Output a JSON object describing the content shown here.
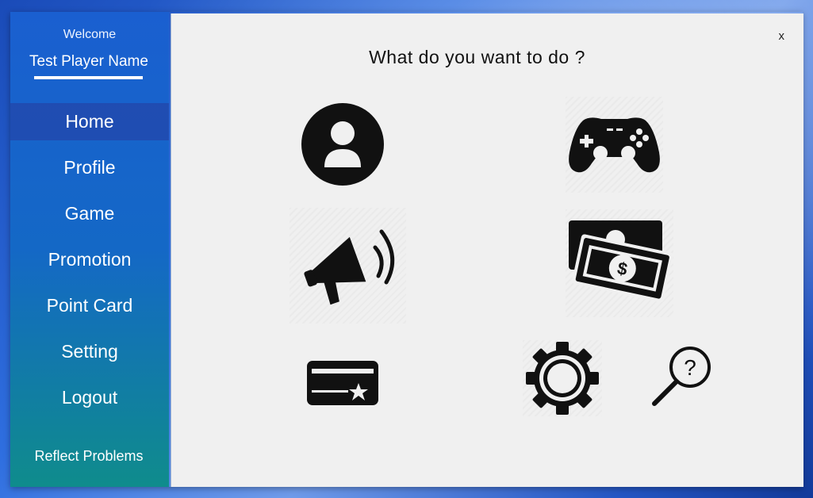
{
  "sidebar": {
    "welcome": "Welcome",
    "player_name": "Test Player Name",
    "items": [
      {
        "label": "Home",
        "active": true
      },
      {
        "label": "Profile",
        "active": false
      },
      {
        "label": "Game",
        "active": false
      },
      {
        "label": "Promotion",
        "active": false
      },
      {
        "label": "Point Card",
        "active": false
      },
      {
        "label": "Setting",
        "active": false
      },
      {
        "label": "Logout",
        "active": false
      }
    ],
    "reflect_label": "Reflect Problems"
  },
  "main": {
    "close_label": "x",
    "title": "What do you want to do ?",
    "tiles": [
      {
        "icon": "profile-user-icon"
      },
      {
        "icon": "gamepad-icon"
      },
      {
        "icon": "megaphone-icon"
      },
      {
        "icon": "money-icon"
      },
      {
        "icon": "point-card-icon"
      },
      {
        "icon": "gear-icon"
      },
      {
        "icon": "help-search-icon"
      }
    ]
  },
  "colors": {
    "sidebar_top": "#1a5fd0",
    "sidebar_bottom": "#0f8c8c",
    "active_item": "#2346aa",
    "content_bg": "#f0f0f0",
    "icon": "#111111"
  }
}
